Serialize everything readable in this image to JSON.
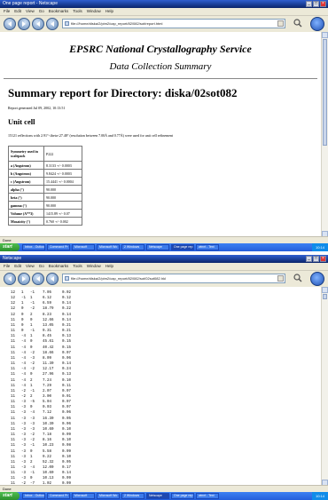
{
  "window1": {
    "title": "One page report - Netscape",
    "menu": [
      "File",
      "Edit",
      "View",
      "Go",
      "Bookmarks",
      "Tools",
      "Window",
      "Help"
    ],
    "url": "file:///home/diska/2/pim2/cap_report/82/082/sot/report.html",
    "page": {
      "service_title": "EPSRC National Crystallography Service",
      "service_subtitle": "Data Collection Summary",
      "report_heading": "Summary report for Directory: diska/02sot082",
      "generated": "Report generated Jul 09, 2002, 10:13:51",
      "unit_cell_heading": "Unit cell",
      "unit_cell_text": "15121 reflections with 2.91°<theta<27.48° (resolution between 7.00Å and 0.77Å) were used for unit cell refinement",
      "table": [
        {
          "label": "Symmetry used in scalepack",
          "value": "P222"
        },
        {
          "label": "a (Angstrom)",
          "value": "8.3133 +/- 0.0003"
        },
        {
          "label": "b (Angstrom)",
          "value": "9.8424 +/- 0.0003"
        },
        {
          "label": "c (Angstrom)",
          "value": "15.4441 +/- 0.0004"
        },
        {
          "label": "alpha (°)",
          "value": "90.000"
        },
        {
          "label": "beta (°)",
          "value": "90.000"
        },
        {
          "label": "gamma (°)",
          "value": "90.000"
        },
        {
          "label": "Volume (A**3)",
          "value": "1415.89 +/- 0.07"
        },
        {
          "label": "Mosaicity (°)",
          "value": "0.760 +/- 0.002"
        }
      ]
    },
    "status": "Done",
    "taskbar": {
      "start": "start",
      "tasks": [
        "Inbox - Outlook",
        "Command Pr",
        "Microsoft",
        "Microsoft Wo",
        "2 Windows",
        "Netscape",
        "One page rep",
        "winnt - Text"
      ],
      "clock": "10:14"
    }
  },
  "window2": {
    "title": "Netscape",
    "menu": [
      "File",
      "Edit",
      "View",
      "Go",
      "Bookmarks",
      "Tools",
      "Window",
      "Help"
    ],
    "url": "file:///home/diska/2/pim2/cap_report/82/082/sot/02sot082.hkl",
    "hkl_rows": [
      [
        "12",
        "1",
        "-1",
        "7.05",
        "0.02"
      ],
      [
        "12",
        "-1",
        "1",
        "6.12",
        "0.12"
      ],
      [
        "12",
        "1",
        "-1",
        "6.59",
        "0.14"
      ],
      [
        "12",
        "0",
        "-2",
        "18.79",
        "0.22"
      ],
      [
        "12",
        "0",
        "2",
        "8.23",
        "0.14"
      ],
      [
        "11",
        "0",
        "0",
        "12.66",
        "0.14"
      ],
      [
        "11",
        "0",
        "1",
        "13.05",
        "0.21"
      ],
      [
        "11",
        "0",
        "-1",
        "9.31",
        "0.21"
      ],
      [
        "11",
        "-4",
        "1",
        "8.45",
        "0.13"
      ],
      [
        "11",
        "-4",
        "0",
        "45.61",
        "0.15"
      ],
      [
        "11",
        "-4",
        "0",
        "40.42",
        "0.15"
      ],
      [
        "11",
        "-4",
        "-2",
        "18.66",
        "0.07"
      ],
      [
        "11",
        "-4",
        "-3",
        "8.09",
        "0.06"
      ],
      [
        "11",
        "-4",
        "-2",
        "11.30",
        "0.14"
      ],
      [
        "11",
        "-4",
        "-2",
        "12.17",
        "0.24"
      ],
      [
        "11",
        "-4",
        "0",
        "27.96",
        "0.13"
      ],
      [
        "11",
        "-4",
        "2",
        "7.24",
        "0.10"
      ],
      [
        "11",
        "-4",
        "1",
        "7.29",
        "0.11"
      ],
      [
        "11",
        "-2",
        "-1",
        "2.07",
        "0.07"
      ],
      [
        "11",
        "-2",
        "2",
        "3.00",
        "0.01"
      ],
      [
        "11",
        "-3",
        "-5",
        "5.04",
        "0.07"
      ],
      [
        "11",
        "-3",
        "0",
        "0.03",
        "0.07"
      ],
      [
        "11",
        "-3",
        "-4",
        "7.12",
        "0.06"
      ],
      [
        "11",
        "-3",
        "-3",
        "16.30",
        "0.05"
      ],
      [
        "11",
        "-3",
        "-3",
        "10.30",
        "0.06"
      ],
      [
        "11",
        "-3",
        "-3",
        "10.60",
        "0.10"
      ],
      [
        "11",
        "-3",
        "-2",
        "7.18",
        "0.09"
      ],
      [
        "11",
        "-3",
        "-2",
        "8.16",
        "0.10"
      ],
      [
        "11",
        "-3",
        "-1",
        "10.23",
        "0.08"
      ],
      [
        "11",
        "-3",
        "0",
        "5.58",
        "0.09"
      ],
      [
        "11",
        "-3",
        "1",
        "9.22",
        "0.10"
      ],
      [
        "11",
        "-3",
        "2",
        "52.32",
        "0.05"
      ],
      [
        "11",
        "-3",
        "-4",
        "12.00",
        "0.17"
      ],
      [
        "11",
        "-3",
        "-1",
        "10.60",
        "0.14"
      ],
      [
        "11",
        "-3",
        "0",
        "10.13",
        "0.09"
      ],
      [
        "11",
        "-2",
        "-7",
        "1.02",
        "0.09"
      ],
      [
        "11",
        "-2",
        "-2",
        "5.23",
        "0.09"
      ],
      [
        "11",
        "-2",
        "-4",
        "8.03",
        "0.07"
      ]
    ],
    "status": "Done",
    "taskbar": {
      "start": "start",
      "tasks": [
        "Inbox - Outlook",
        "Command Pr",
        "Microsoft",
        "Microsoft Wo",
        "2 Windows",
        "Netscape",
        "One page rep",
        "winnt - Text"
      ],
      "clock": "10:14"
    }
  }
}
